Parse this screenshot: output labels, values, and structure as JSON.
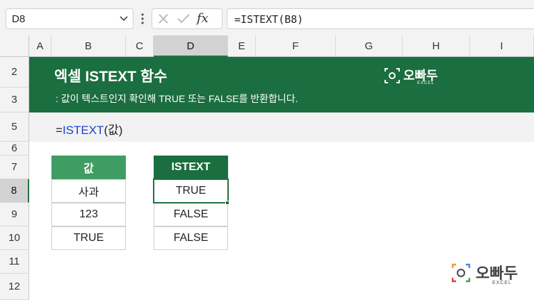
{
  "formula_bar": {
    "name_box": "D8",
    "formula": "=ISTEXT(B8)",
    "cancel_icon": "x-icon",
    "enter_icon": "checkmark-icon",
    "function_icon": "fx"
  },
  "columns": [
    "A",
    "B",
    "C",
    "D",
    "E",
    "F",
    "G",
    "H",
    "I"
  ],
  "selected_column": "D",
  "rows": [
    "2",
    "3",
    "5",
    "6",
    "7",
    "8",
    "9",
    "10",
    "11",
    "12"
  ],
  "selected_row": "8",
  "banner": {
    "title": "엑셀 ISTEXT 함수",
    "subtitle": ": 값이 텍스트인지 확인해 TRUE 또는 FALSE를 반환합니다.",
    "logo_text": "오빠두",
    "logo_sub": "EXCEL"
  },
  "syntax": {
    "prefix": "=",
    "function": "ISTEXT",
    "args": "(값)"
  },
  "table_left": {
    "header": "값",
    "values": [
      "사과",
      "123",
      "TRUE"
    ]
  },
  "table_right": {
    "header": "ISTEXT",
    "values": [
      "TRUE",
      "FALSE",
      "FALSE"
    ]
  },
  "watermark": {
    "text": "오빠두",
    "sub": "EXCEL"
  },
  "colors": {
    "banner": "#1b6e3f",
    "header_left": "#3f9d63",
    "function_blue": "#1a3fd6"
  }
}
